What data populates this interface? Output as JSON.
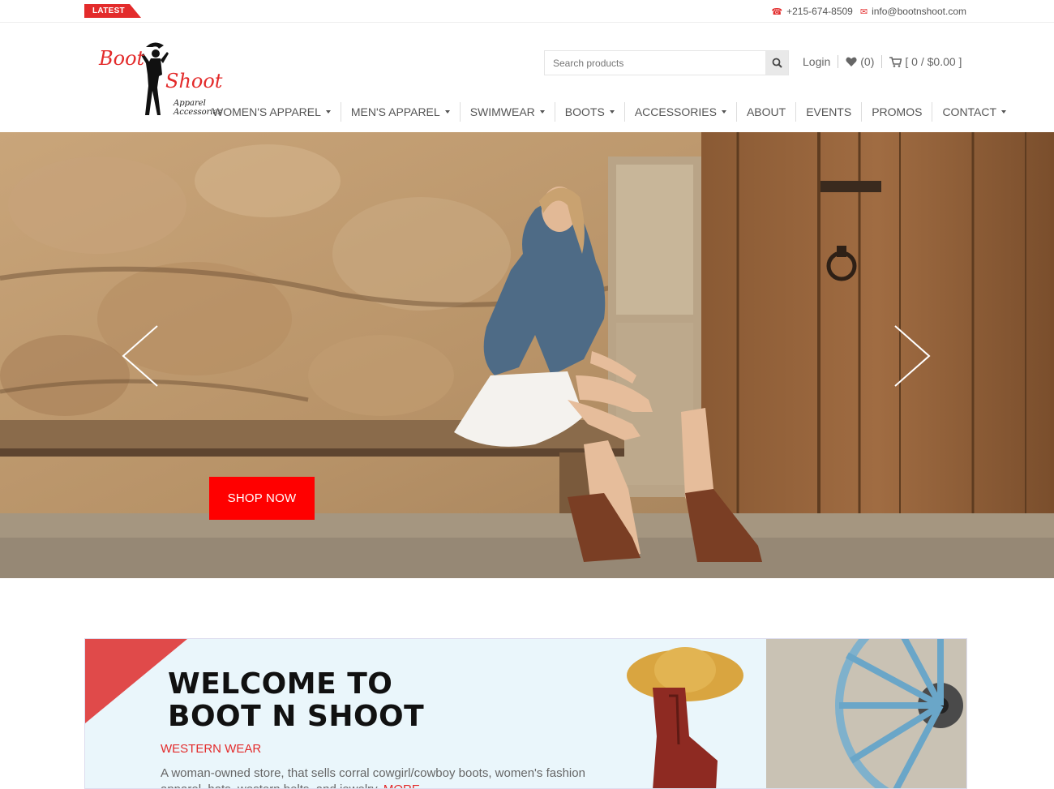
{
  "topbar": {
    "latest_label": "LATEST",
    "phone": "+215-674-8509",
    "email": "info@bootnshoot.com"
  },
  "logo": {
    "word1": "Boot",
    "word2": "Shoot",
    "subtitle": "Apparel Accessories"
  },
  "search": {
    "placeholder": "Search products"
  },
  "account": {
    "login": "Login",
    "wishlist": "(0)",
    "cart": "[ 0 / $0.00 ]"
  },
  "nav": {
    "items": [
      {
        "label": "WOMEN'S APPAREL",
        "dropdown": true
      },
      {
        "label": "MEN'S APPAREL",
        "dropdown": true
      },
      {
        "label": "SWIMWEAR",
        "dropdown": true
      },
      {
        "label": "BOOTS",
        "dropdown": true
      },
      {
        "label": "ACCESSORIES",
        "dropdown": true
      },
      {
        "label": "ABOUT",
        "dropdown": false
      },
      {
        "label": "EVENTS",
        "dropdown": false
      },
      {
        "label": "PROMOS",
        "dropdown": false
      },
      {
        "label": "CONTACT",
        "dropdown": true
      }
    ]
  },
  "hero": {
    "cta": "SHOP NOW"
  },
  "welcome": {
    "title_line1": "WELCOME TO",
    "title_line2": "BOOT N SHOOT",
    "tagline": "WESTERN WEAR",
    "body": "A woman-owned store, that sells corral cowgirl/cowboy boots, women's fashion apparel, hats, western belts, and jewelry.",
    "more": "MORE"
  },
  "colors": {
    "accent": "#e32b2b",
    "cta": "#ff0000"
  }
}
